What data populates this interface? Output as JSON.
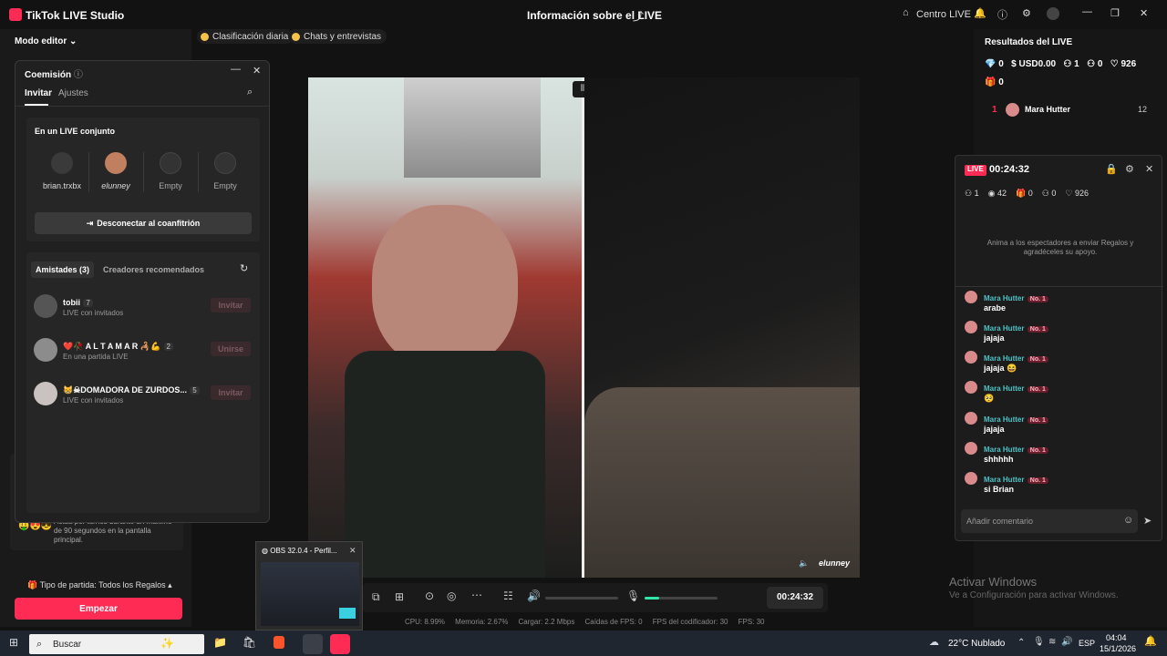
{
  "titlebar": {
    "app_title": "TikTok LIVE Studio",
    "center_title": "Información sobre el LIVE",
    "centro_live": "Centro LIVE"
  },
  "left": {
    "mode": "Modo editor",
    "tip_text": "Actúa por turnos durante un máximo de 90 segundos en la pantalla principal.",
    "party_type": "Tipo de partida: Todos los Regalos",
    "start_button": "Empezar"
  },
  "chips": [
    "Clasificación diaria",
    "Chats y entrevistas"
  ],
  "modal": {
    "title": "Coemisión",
    "tabs": [
      "Invitar",
      "Ajustes"
    ],
    "joint_title": "En un LIVE conjunto",
    "slots": [
      "brian.trxbx",
      "elunney",
      "Empty",
      "Empty"
    ],
    "disconnect": "Desconectar al coanfitrión",
    "friends_tab": "Amistades (3)",
    "recommended_tab": "Creadores recomendados",
    "friends": [
      {
        "name": "tobii",
        "count": "7",
        "status": "LIVE con invitados",
        "action": "Invitar"
      },
      {
        "name": "❤️🥀 A L T A M A R 🦂💪",
        "count": "2",
        "status": "En una partida LIVE",
        "action": "Unirse"
      },
      {
        "name": "😸☠DOMADORA DE ZURDOS...",
        "count": "5",
        "status": "LIVE con invitados",
        "action": "Invitar"
      }
    ]
  },
  "video": {
    "right_name": "elunney",
    "timer": "00:24:32"
  },
  "stats": {
    "cpu": "CPU: 8.99%",
    "memoria": "Memoria: 2.67%",
    "cargar": "Cargar: 2.2 Mbps",
    "caidas": "Caídas de FPS: 0",
    "fps_cod": "FPS del codificador: 30",
    "fps": "FPS: 30"
  },
  "results": {
    "title": "Resultados del LIVE",
    "diamonds": "0",
    "usd": "USD0.00",
    "viewers": "1",
    "shares": "0",
    "likes": "926",
    "gifts": "0",
    "rank": "1",
    "top_user": "Mara Hutter",
    "top_score": "12"
  },
  "live_panel": {
    "badge": "LIVE",
    "time": "00:24:32",
    "stat_users": "1",
    "stat_views": "42",
    "stat_gifts": "0",
    "stat_shares": "0",
    "stat_likes": "926",
    "prompt": "Anima a los espectadores a enviar Regalos y agradéceles su apoyo.",
    "comment_placeholder": "Añadir comentario",
    "messages": [
      {
        "user": "Mara Hutter",
        "rank": "No. 1",
        "text": "arabe"
      },
      {
        "user": "Mara Hutter",
        "rank": "No. 1",
        "text": "jajaja"
      },
      {
        "user": "Mara Hutter",
        "rank": "No. 1",
        "text": "jajaja 😆"
      },
      {
        "user": "Mara Hutter",
        "rank": "No. 1",
        "text": "🥺"
      },
      {
        "user": "Mara Hutter",
        "rank": "No. 1",
        "text": "jajaja"
      },
      {
        "user": "Mara Hutter",
        "rank": "No. 1",
        "text": "shhhhh"
      },
      {
        "user": "Mara Hutter",
        "rank": "No. 1",
        "text": "si Brian"
      }
    ]
  },
  "obs": {
    "title": "OBS 32.0.4 - Perfil..."
  },
  "windows": {
    "activate_title": "Activar Windows",
    "activate_sub": "Ve a Configuración para activar Windows.",
    "search": "Buscar",
    "weather": "22°C  Nublado",
    "lang": "ESP",
    "time": "04:04",
    "date": "15/1/2026"
  },
  "colors": {
    "accent": "#fe2c55",
    "teal": "#4fc3c7"
  }
}
